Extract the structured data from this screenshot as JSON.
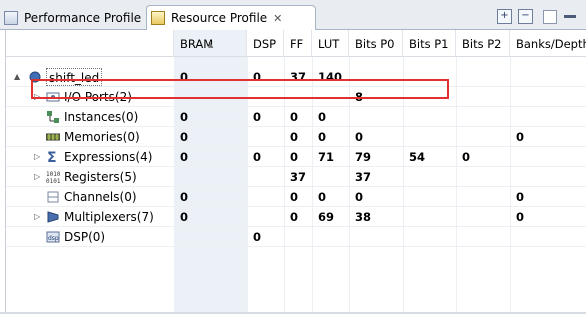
{
  "tabs": [
    {
      "label": "Performance Profile",
      "active": false
    },
    {
      "label": "Resource Profile",
      "active": true
    }
  ],
  "tab_close_symbol": "✕",
  "toolbar": {
    "expand_all_icon": "expand-all-icon",
    "collapse_all_icon": "collapse-all-icon"
  },
  "columns": [
    "BRAM",
    "DSP",
    "FF",
    "LUT",
    "Bits P0",
    "Bits P1",
    "Bits P2",
    "Banks/Depth"
  ],
  "rows": [
    {
      "name": "shift_led",
      "expander": "▲",
      "icon": "module-icon",
      "values": [
        "0",
        "0",
        "37",
        "140",
        "",
        "",
        "",
        ""
      ]
    },
    {
      "name": "I/O Ports(2)",
      "expander": "▷",
      "icon": "ports-icon",
      "values": [
        "",
        "",
        "",
        "",
        "8",
        "",
        "",
        ""
      ]
    },
    {
      "name": "Instances(0)",
      "expander": "",
      "icon": "instances-icon",
      "values": [
        "0",
        "0",
        "0",
        "0",
        "",
        "",
        "",
        ""
      ]
    },
    {
      "name": "Memories(0)",
      "expander": "",
      "icon": "memory-icon",
      "values": [
        "0",
        "",
        "0",
        "0",
        "0",
        "",
        "",
        "0"
      ]
    },
    {
      "name": "Expressions(4)",
      "expander": "▷",
      "icon": "sigma-icon",
      "values": [
        "0",
        "0",
        "0",
        "71",
        "79",
        "54",
        "0",
        ""
      ]
    },
    {
      "name": "Registers(5)",
      "expander": "▷",
      "icon": "registers-icon",
      "values": [
        "",
        "",
        "37",
        "",
        "37",
        "",
        "",
        ""
      ]
    },
    {
      "name": "Channels(0)",
      "expander": "",
      "icon": "channels-icon",
      "values": [
        "0",
        "",
        "0",
        "0",
        "0",
        "",
        "",
        "0"
      ]
    },
    {
      "name": "Multiplexers(7)",
      "expander": "▷",
      "icon": "mux-icon",
      "values": [
        "0",
        "",
        "0",
        "69",
        "38",
        "",
        "",
        "0"
      ]
    },
    {
      "name": "DSP(0)",
      "expander": "",
      "icon": "dsp-icon",
      "values": [
        "",
        "0",
        "",
        "",
        "",
        "",
        "",
        ""
      ]
    }
  ],
  "colors": {
    "highlight_border": "#e03030",
    "bram_column_shade": "#ecf1f8"
  }
}
